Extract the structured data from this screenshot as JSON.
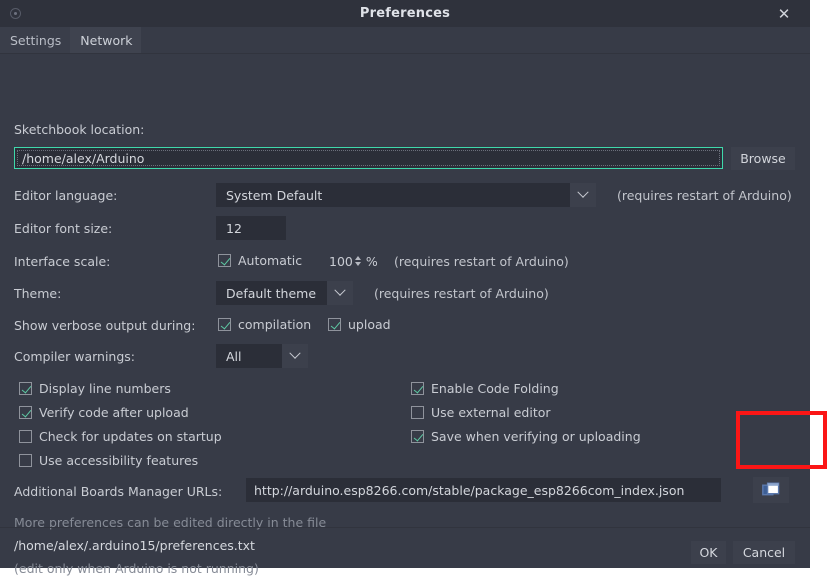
{
  "window": {
    "title": "Preferences",
    "close_label": "✕",
    "app_icon": "arduino-circle-icon"
  },
  "tabs": [
    {
      "label": "Settings",
      "active": true
    },
    {
      "label": "Network",
      "active": false
    }
  ],
  "settings": {
    "sketchbook": {
      "label": "Sketchbook location:",
      "value": "/home/alex/Arduino",
      "browse_label": "Browse"
    },
    "editor_language": {
      "label": "Editor language:",
      "value": "System Default",
      "note": "(requires restart of Arduino)"
    },
    "editor_font_size": {
      "label": "Editor font size:",
      "value": "12"
    },
    "interface_scale": {
      "label": "Interface scale:",
      "automatic_label": "Automatic",
      "automatic_checked": true,
      "percent_value": "100",
      "percent_symbol": "%",
      "note": "(requires restart of Arduino)"
    },
    "theme": {
      "label": "Theme:",
      "value": "Default theme",
      "note": "(requires restart of Arduino)"
    },
    "verbose_output": {
      "label": "Show verbose output during:",
      "compilation_label": "compilation",
      "compilation_checked": true,
      "upload_label": "upload",
      "upload_checked": true
    },
    "compiler_warnings": {
      "label": "Compiler warnings:",
      "value": "All"
    },
    "checkboxes_left": [
      {
        "label": "Display line numbers",
        "checked": true
      },
      {
        "label": "Verify code after upload",
        "checked": true
      },
      {
        "label": "Check for updates on startup",
        "checked": false
      },
      {
        "label": "Use accessibility features",
        "checked": false
      }
    ],
    "checkboxes_right": [
      {
        "label": "Enable Code Folding",
        "checked": true
      },
      {
        "label": "Use external editor",
        "checked": false
      },
      {
        "label": "Save when verifying or uploading",
        "checked": true
      }
    ],
    "boards_urls": {
      "label": "Additional Boards Manager URLs:",
      "value": "http://arduino.esp8266.com/stable/package_esp8266com_index.json",
      "button_icon": "open-window-icon"
    },
    "more_prefs": {
      "line1": "More preferences can be edited directly in the file",
      "line2": "/home/alex/.arduino15/preferences.txt",
      "line3": "(edit only when Arduino is not running)"
    }
  },
  "footer": {
    "ok_label": "OK",
    "cancel_label": "Cancel"
  },
  "annotation": {
    "highlight_color": "#fb1616",
    "target": "boards-urls-open-window-button"
  },
  "colors": {
    "window_bg": "#373b47",
    "titlebar_bg": "#2f323c",
    "field_bg": "#2b2e38",
    "button_bg": "#3c404c",
    "focus_border": "#3fd9ab",
    "check_color": "#5ec9a4",
    "text": "#c9ccd3",
    "dim_text": "#868b96"
  }
}
